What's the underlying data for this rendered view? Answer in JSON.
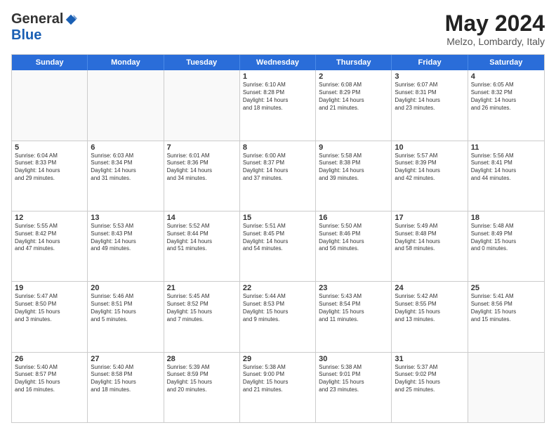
{
  "logo": {
    "general": "General",
    "blue": "Blue"
  },
  "title": "May 2024",
  "location": "Melzo, Lombardy, Italy",
  "days": [
    "Sunday",
    "Monday",
    "Tuesday",
    "Wednesday",
    "Thursday",
    "Friday",
    "Saturday"
  ],
  "weeks": [
    [
      {
        "day": "",
        "info": ""
      },
      {
        "day": "",
        "info": ""
      },
      {
        "day": "",
        "info": ""
      },
      {
        "day": "1",
        "info": "Sunrise: 6:10 AM\nSunset: 8:28 PM\nDaylight: 14 hours\nand 18 minutes."
      },
      {
        "day": "2",
        "info": "Sunrise: 6:08 AM\nSunset: 8:29 PM\nDaylight: 14 hours\nand 21 minutes."
      },
      {
        "day": "3",
        "info": "Sunrise: 6:07 AM\nSunset: 8:31 PM\nDaylight: 14 hours\nand 23 minutes."
      },
      {
        "day": "4",
        "info": "Sunrise: 6:05 AM\nSunset: 8:32 PM\nDaylight: 14 hours\nand 26 minutes."
      }
    ],
    [
      {
        "day": "5",
        "info": "Sunrise: 6:04 AM\nSunset: 8:33 PM\nDaylight: 14 hours\nand 29 minutes."
      },
      {
        "day": "6",
        "info": "Sunrise: 6:03 AM\nSunset: 8:34 PM\nDaylight: 14 hours\nand 31 minutes."
      },
      {
        "day": "7",
        "info": "Sunrise: 6:01 AM\nSunset: 8:36 PM\nDaylight: 14 hours\nand 34 minutes."
      },
      {
        "day": "8",
        "info": "Sunrise: 6:00 AM\nSunset: 8:37 PM\nDaylight: 14 hours\nand 37 minutes."
      },
      {
        "day": "9",
        "info": "Sunrise: 5:58 AM\nSunset: 8:38 PM\nDaylight: 14 hours\nand 39 minutes."
      },
      {
        "day": "10",
        "info": "Sunrise: 5:57 AM\nSunset: 8:39 PM\nDaylight: 14 hours\nand 42 minutes."
      },
      {
        "day": "11",
        "info": "Sunrise: 5:56 AM\nSunset: 8:41 PM\nDaylight: 14 hours\nand 44 minutes."
      }
    ],
    [
      {
        "day": "12",
        "info": "Sunrise: 5:55 AM\nSunset: 8:42 PM\nDaylight: 14 hours\nand 47 minutes."
      },
      {
        "day": "13",
        "info": "Sunrise: 5:53 AM\nSunset: 8:43 PM\nDaylight: 14 hours\nand 49 minutes."
      },
      {
        "day": "14",
        "info": "Sunrise: 5:52 AM\nSunset: 8:44 PM\nDaylight: 14 hours\nand 51 minutes."
      },
      {
        "day": "15",
        "info": "Sunrise: 5:51 AM\nSunset: 8:45 PM\nDaylight: 14 hours\nand 54 minutes."
      },
      {
        "day": "16",
        "info": "Sunrise: 5:50 AM\nSunset: 8:46 PM\nDaylight: 14 hours\nand 56 minutes."
      },
      {
        "day": "17",
        "info": "Sunrise: 5:49 AM\nSunset: 8:48 PM\nDaylight: 14 hours\nand 58 minutes."
      },
      {
        "day": "18",
        "info": "Sunrise: 5:48 AM\nSunset: 8:49 PM\nDaylight: 15 hours\nand 0 minutes."
      }
    ],
    [
      {
        "day": "19",
        "info": "Sunrise: 5:47 AM\nSunset: 8:50 PM\nDaylight: 15 hours\nand 3 minutes."
      },
      {
        "day": "20",
        "info": "Sunrise: 5:46 AM\nSunset: 8:51 PM\nDaylight: 15 hours\nand 5 minutes."
      },
      {
        "day": "21",
        "info": "Sunrise: 5:45 AM\nSunset: 8:52 PM\nDaylight: 15 hours\nand 7 minutes."
      },
      {
        "day": "22",
        "info": "Sunrise: 5:44 AM\nSunset: 8:53 PM\nDaylight: 15 hours\nand 9 minutes."
      },
      {
        "day": "23",
        "info": "Sunrise: 5:43 AM\nSunset: 8:54 PM\nDaylight: 15 hours\nand 11 minutes."
      },
      {
        "day": "24",
        "info": "Sunrise: 5:42 AM\nSunset: 8:55 PM\nDaylight: 15 hours\nand 13 minutes."
      },
      {
        "day": "25",
        "info": "Sunrise: 5:41 AM\nSunset: 8:56 PM\nDaylight: 15 hours\nand 15 minutes."
      }
    ],
    [
      {
        "day": "26",
        "info": "Sunrise: 5:40 AM\nSunset: 8:57 PM\nDaylight: 15 hours\nand 16 minutes."
      },
      {
        "day": "27",
        "info": "Sunrise: 5:40 AM\nSunset: 8:58 PM\nDaylight: 15 hours\nand 18 minutes."
      },
      {
        "day": "28",
        "info": "Sunrise: 5:39 AM\nSunset: 8:59 PM\nDaylight: 15 hours\nand 20 minutes."
      },
      {
        "day": "29",
        "info": "Sunrise: 5:38 AM\nSunset: 9:00 PM\nDaylight: 15 hours\nand 21 minutes."
      },
      {
        "day": "30",
        "info": "Sunrise: 5:38 AM\nSunset: 9:01 PM\nDaylight: 15 hours\nand 23 minutes."
      },
      {
        "day": "31",
        "info": "Sunrise: 5:37 AM\nSunset: 9:02 PM\nDaylight: 15 hours\nand 25 minutes."
      },
      {
        "day": "",
        "info": ""
      }
    ]
  ]
}
